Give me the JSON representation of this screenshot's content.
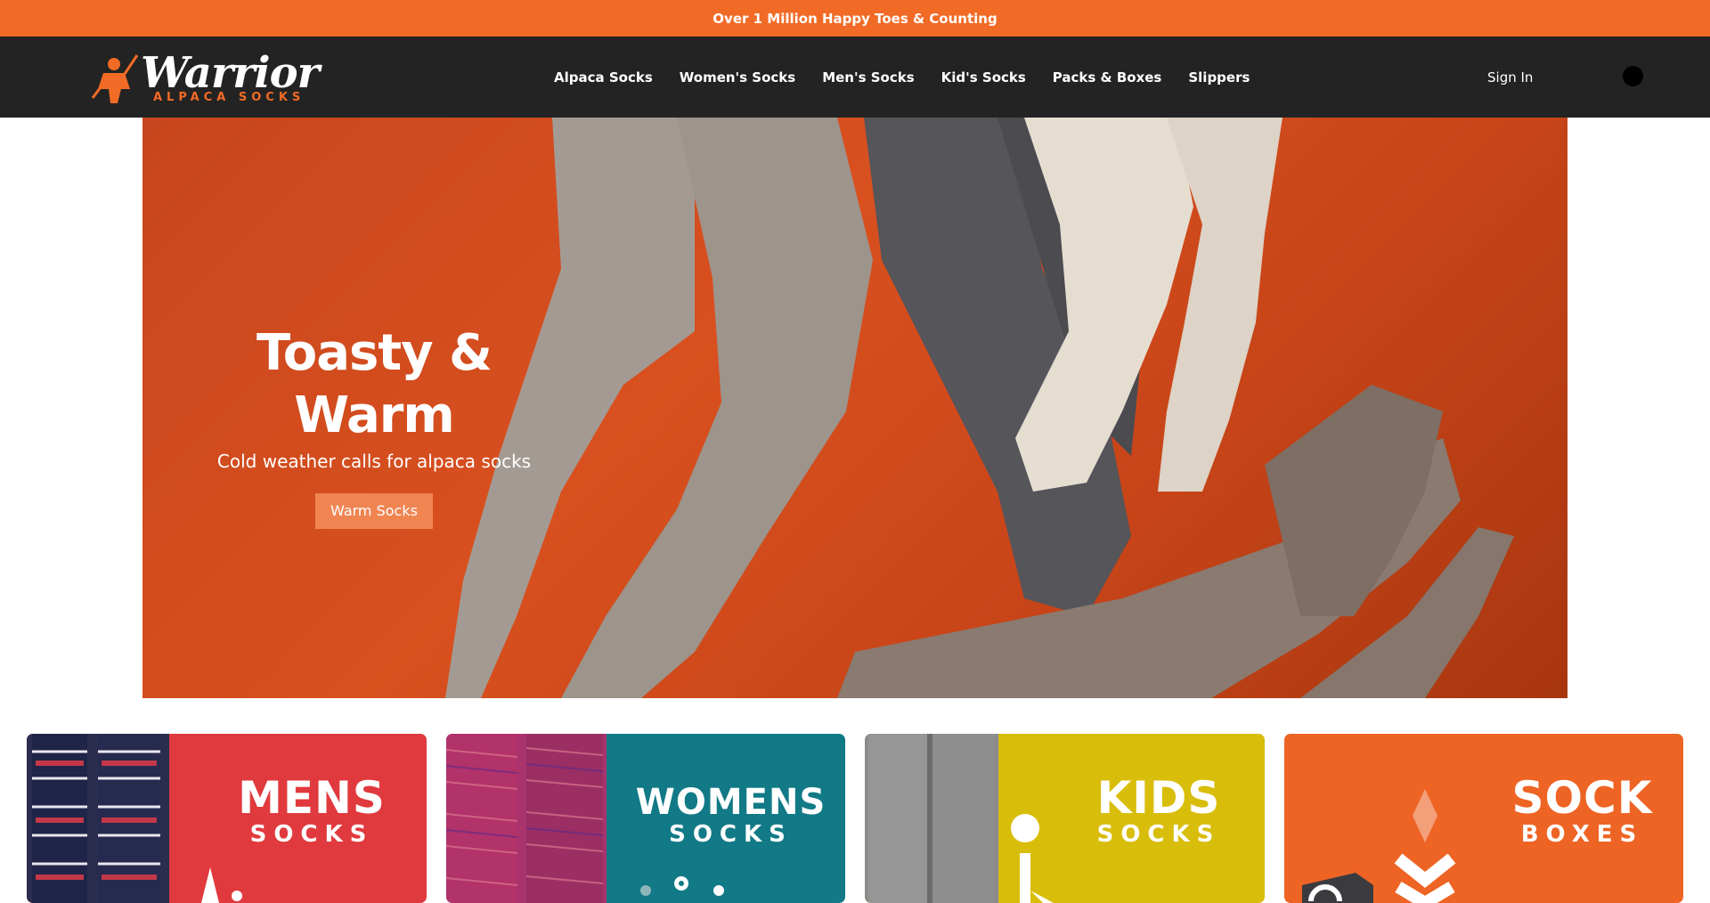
{
  "announcement": "Over 1 Million Happy Toes & Counting",
  "brand": {
    "name": "Warrior",
    "tagline": "ALPACA SOCKS"
  },
  "nav": [
    {
      "label": "Alpaca Socks"
    },
    {
      "label": "Women's Socks"
    },
    {
      "label": "Men's Socks"
    },
    {
      "label": "Kid's Socks"
    },
    {
      "label": "Packs & Boxes"
    },
    {
      "label": "Slippers"
    }
  ],
  "account": {
    "signin": "Sign In"
  },
  "hero": {
    "title": "Toasty & Warm",
    "subtitle": "Cold weather calls for alpaca socks",
    "cta": "Warm Socks"
  },
  "categories": [
    {
      "big": "MENS",
      "small": "SOCKS",
      "color": "#e03a3e"
    },
    {
      "big": "WOMENS",
      "small": "SOCKS",
      "color": "#117a86"
    },
    {
      "big": "KIDS",
      "small": "SOCKS",
      "color": "#d9bd0b"
    },
    {
      "big": "SOCK",
      "small": "BOXES",
      "color": "#ee6424"
    }
  ],
  "colors": {
    "accent": "#f26b26",
    "header_bg": "#232323"
  }
}
